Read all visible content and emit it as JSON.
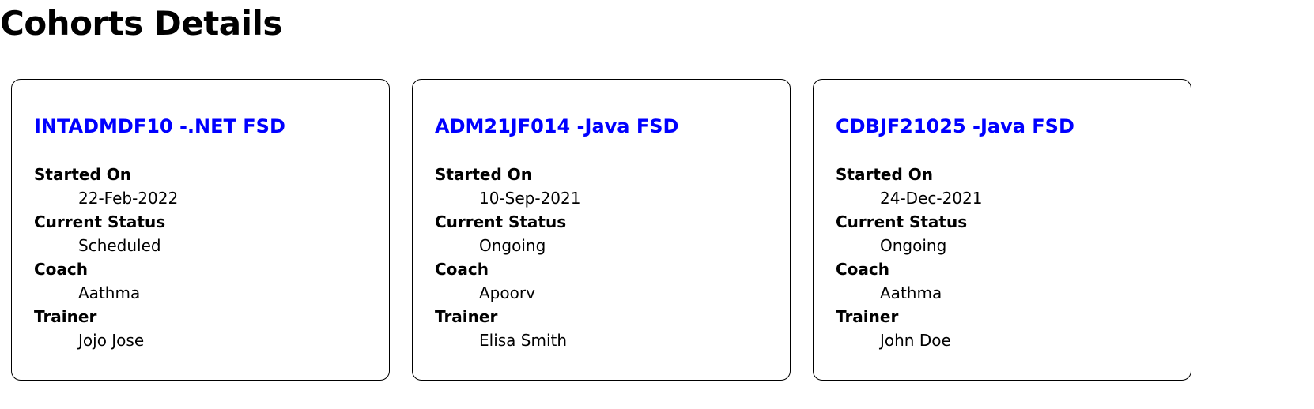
{
  "page": {
    "title": "Cohorts Details"
  },
  "colors": {
    "card_title": "#0000ff",
    "border": "#000000"
  },
  "labels": {
    "started_on": "Started On",
    "current_status": "Current Status",
    "coach": "Coach",
    "trainer": "Trainer"
  },
  "cohorts": [
    {
      "title": "INTADMDF10 -.NET FSD",
      "started_on": "22-Feb-2022",
      "current_status": "Scheduled",
      "coach": "Aathma",
      "trainer": "Jojo Jose"
    },
    {
      "title": "ADM21JF014 -Java FSD",
      "started_on": "10-Sep-2021",
      "current_status": "Ongoing",
      "coach": "Apoorv",
      "trainer": "Elisa Smith"
    },
    {
      "title": "CDBJF21025 -Java FSD",
      "started_on": "24-Dec-2021",
      "current_status": "Ongoing",
      "coach": "Aathma",
      "trainer": "John Doe"
    }
  ]
}
